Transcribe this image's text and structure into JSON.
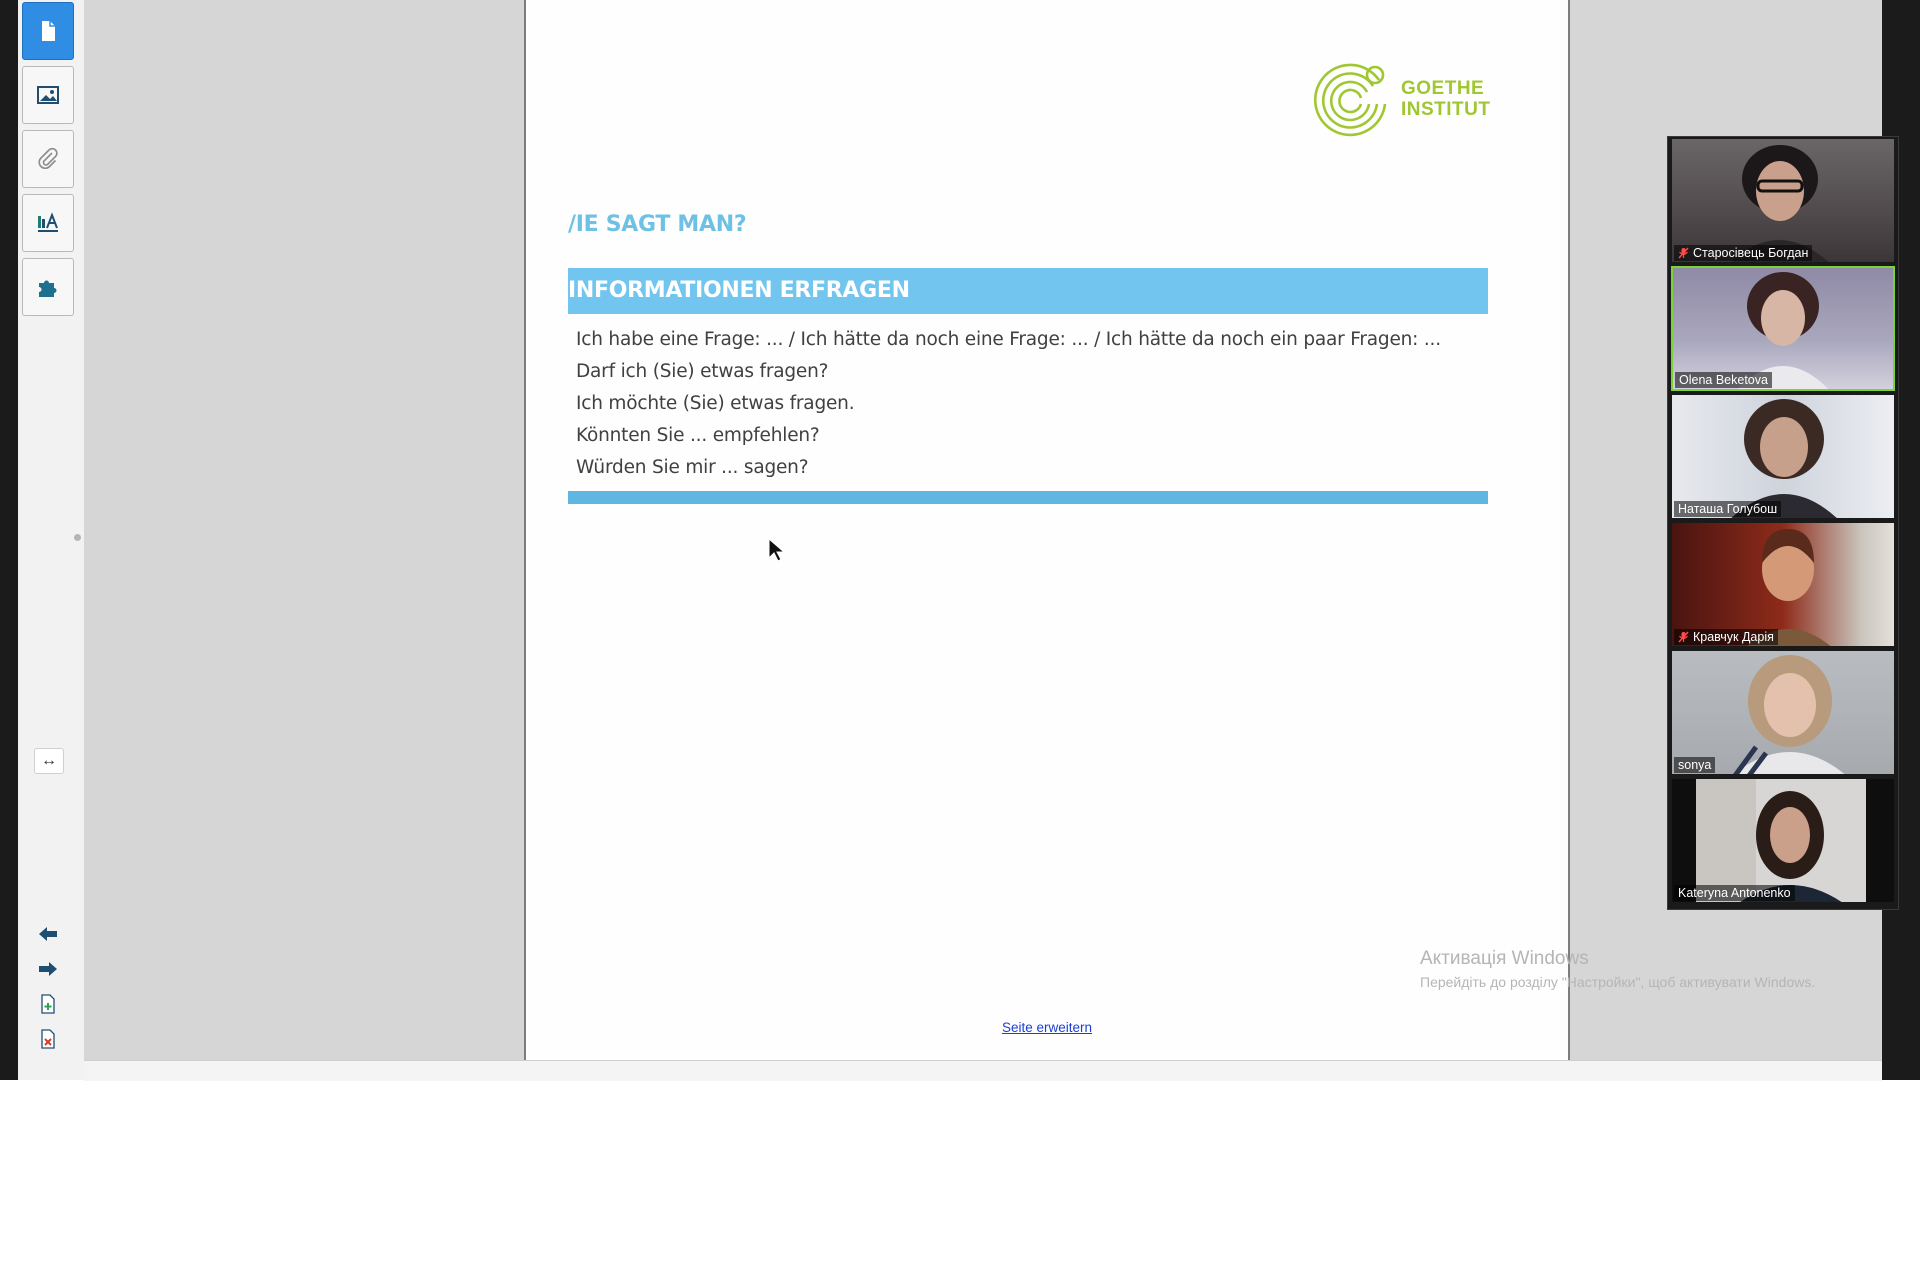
{
  "toolbar": {
    "tools": [
      {
        "icon": "document-icon",
        "active": true
      },
      {
        "icon": "image-icon",
        "active": false
      },
      {
        "icon": "paperclip-icon",
        "active": false
      },
      {
        "icon": "text-style-icon",
        "active": false
      },
      {
        "icon": "puzzle-icon",
        "active": false
      }
    ],
    "expand_icon": "↔",
    "nav": [
      "arrow-left-icon",
      "arrow-right-icon",
      "add-page-icon",
      "delete-page-icon"
    ]
  },
  "slide": {
    "logo_text_line1": "GOETHE",
    "logo_text_line2": "INSTITUT",
    "heading": "/IE SAGT MAN?",
    "section_title": "INFORMATIONEN ERFRAGEN",
    "phrases": [
      "Ich habe eine Frage: ... / Ich hätte da noch eine Frage: ... / Ich hätte da noch ein paar Fragen: ...",
      "Darf ich (Sie) etwas fragen?",
      "Ich möchte (Sie) etwas fragen.",
      "Könnten Sie ... empfehlen?",
      "Würden Sie mir ... sagen?"
    ],
    "extend_link": "Seite erweitern"
  },
  "participants": [
    {
      "name": "Старосівець Богдан",
      "muted": true,
      "speaking": false
    },
    {
      "name": "Olena Beketova",
      "muted": false,
      "speaking": true
    },
    {
      "name": "Наташа Голубош",
      "muted": false,
      "speaking": false
    },
    {
      "name": "Кравчук Дарія",
      "muted": true,
      "speaking": false
    },
    {
      "name": "sonya",
      "muted": false,
      "speaking": false
    },
    {
      "name": "Kateryna Antonenko",
      "muted": false,
      "speaking": false
    }
  ],
  "watermark": {
    "title": "Активація Windows",
    "subtitle": "Перейдіть до розділу \"Настройки\", щоб активувати Windows."
  },
  "colors": {
    "accent_blue": "#2f8de4",
    "slide_band": "#72c5ee",
    "goethe_green": "#a0c732",
    "speaking_border": "#7bd33a"
  }
}
